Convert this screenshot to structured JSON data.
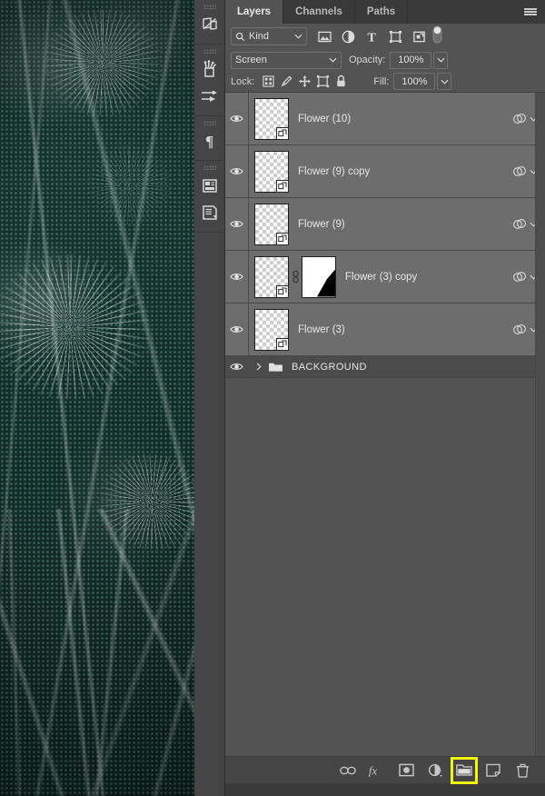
{
  "app": "Adobe Photoshop Layers Panel",
  "canvas": {
    "artwork_description": "Dark teal chalk-drawn floral illustration with halftone dot texture",
    "background_color": "#15322d",
    "stroke_color": "#e1ebe8"
  },
  "icon_dock": {
    "items": [
      {
        "name": "libraries-icon",
        "tooltip": "Libraries"
      },
      {
        "name": "brushes-icon",
        "tooltip": "Brushes"
      },
      {
        "name": "brush-settings-icon",
        "tooltip": "Brush Settings"
      },
      {
        "name": "paragraph-icon",
        "tooltip": "Paragraph"
      },
      {
        "name": "properties-icon",
        "tooltip": "Properties"
      },
      {
        "name": "layer-comps-icon",
        "tooltip": "Layer Comps"
      }
    ]
  },
  "panel": {
    "tabs": [
      {
        "label": "Layers",
        "active": true
      },
      {
        "label": "Channels",
        "active": false
      },
      {
        "label": "Paths",
        "active": false
      }
    ],
    "menu_icon": "hamburger-menu-icon"
  },
  "filter_bar": {
    "kind_label": "Kind",
    "search_icon": "search-icon",
    "chevron_icon": "chevron-down-icon",
    "filter_icons": [
      {
        "name": "filter-pixel-icon",
        "label": "Pixel layers"
      },
      {
        "name": "filter-adjustment-icon",
        "label": "Adjustment layers"
      },
      {
        "name": "filter-type-icon",
        "label": "Type layers"
      },
      {
        "name": "filter-shape-icon",
        "label": "Shape layers"
      },
      {
        "name": "filter-smart-object-icon",
        "label": "Smart objects"
      }
    ],
    "toggle_name": "filter-enable-toggle"
  },
  "blend_bar": {
    "blend_mode": "Screen",
    "opacity_label": "Opacity:",
    "opacity_value": "100%"
  },
  "lock_bar": {
    "lock_label": "Lock:",
    "fill_label": "Fill:",
    "fill_value": "100%",
    "lock_icons": [
      {
        "name": "lock-transparent-pixels-icon",
        "label": "Lock transparent pixels"
      },
      {
        "name": "lock-image-pixels-icon",
        "label": "Lock image pixels"
      },
      {
        "name": "lock-position-icon",
        "label": "Lock position"
      },
      {
        "name": "lock-artboard-nesting-icon",
        "label": "Prevent auto-nesting"
      },
      {
        "name": "lock-all-icon",
        "label": "Lock all"
      }
    ]
  },
  "layers": [
    {
      "name": "Flower (10)",
      "type": "smart-object",
      "visible": true,
      "has_mask": false,
      "has_fx_indicator": true
    },
    {
      "name": "Flower (9) copy",
      "type": "smart-object",
      "visible": true,
      "has_mask": false,
      "has_fx_indicator": true
    },
    {
      "name": "Flower (9)",
      "type": "smart-object",
      "visible": true,
      "has_mask": false,
      "has_fx_indicator": true
    },
    {
      "name": "Flower (3) copy",
      "type": "smart-object",
      "visible": true,
      "has_mask": true,
      "has_fx_indicator": true
    },
    {
      "name": "Flower (3)",
      "type": "smart-object",
      "visible": true,
      "has_mask": false,
      "has_fx_indicator": true
    }
  ],
  "group": {
    "name": "BACKGROUND",
    "visible": true,
    "expanded": false
  },
  "bottom_bar": {
    "buttons": [
      {
        "name": "link-layers-button",
        "label": "Link layers",
        "highlighted": false
      },
      {
        "name": "layer-style-button",
        "label": "Add a layer style",
        "highlighted": false
      },
      {
        "name": "layer-mask-button",
        "label": "Add layer mask",
        "highlighted": false
      },
      {
        "name": "adjustment-layer-button",
        "label": "Create new fill or adjustment layer",
        "highlighted": false
      },
      {
        "name": "new-group-button",
        "label": "Create a new group",
        "highlighted": true
      },
      {
        "name": "new-layer-button",
        "label": "Create a new layer",
        "highlighted": false
      },
      {
        "name": "delete-layer-button",
        "label": "Delete layer",
        "highlighted": false
      }
    ],
    "highlight_color": "#f2f50a"
  }
}
